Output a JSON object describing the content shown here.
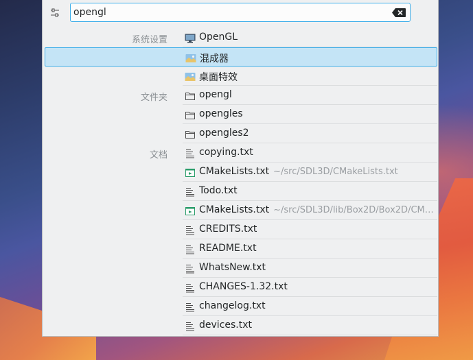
{
  "search": {
    "value": "opengl"
  },
  "results": [
    {
      "category": "系统设置",
      "title": "OpenGL",
      "subtitle": "",
      "icon": "monitor-icon",
      "selected": false
    },
    {
      "category": "",
      "title": "混成器",
      "subtitle": "",
      "icon": "image-icon",
      "selected": true
    },
    {
      "category": "",
      "title": "桌面特效",
      "subtitle": "",
      "icon": "image-icon",
      "selected": false
    },
    {
      "category": "文件夹",
      "title": "opengl",
      "subtitle": "",
      "icon": "folder-icon",
      "selected": false
    },
    {
      "category": "",
      "title": "opengles",
      "subtitle": "",
      "icon": "folder-icon",
      "selected": false
    },
    {
      "category": "",
      "title": "opengles2",
      "subtitle": "",
      "icon": "folder-icon",
      "selected": false
    },
    {
      "category": "文档",
      "title": "copying.txt",
      "subtitle": "",
      "icon": "text-file-icon",
      "selected": false
    },
    {
      "category": "",
      "title": "CMakeLists.txt",
      "subtitle": "~/src/SDL3D/CMakeLists.txt",
      "icon": "cmake-file-icon",
      "selected": false
    },
    {
      "category": "",
      "title": "Todo.txt",
      "subtitle": "",
      "icon": "text-file-icon",
      "selected": false
    },
    {
      "category": "",
      "title": "CMakeLists.txt",
      "subtitle": "~/src/SDL3D/lib/Box2D/Box2D/CM…",
      "icon": "cmake-file-icon",
      "selected": false
    },
    {
      "category": "",
      "title": "CREDITS.txt",
      "subtitle": "",
      "icon": "text-file-icon",
      "selected": false
    },
    {
      "category": "",
      "title": "README.txt",
      "subtitle": "",
      "icon": "text-file-icon",
      "selected": false
    },
    {
      "category": "",
      "title": "WhatsNew.txt",
      "subtitle": "",
      "icon": "text-file-icon",
      "selected": false
    },
    {
      "category": "",
      "title": "CHANGES-1.32.txt",
      "subtitle": "",
      "icon": "text-file-icon",
      "selected": false
    },
    {
      "category": "",
      "title": "changelog.txt",
      "subtitle": "",
      "icon": "text-file-icon",
      "selected": false
    },
    {
      "category": "",
      "title": "devices.txt",
      "subtitle": "",
      "icon": "text-file-icon",
      "selected": false
    }
  ],
  "colors": {
    "accent": "#3daee9",
    "selection": "#c4e4f6",
    "panel": "#eff0f1"
  }
}
